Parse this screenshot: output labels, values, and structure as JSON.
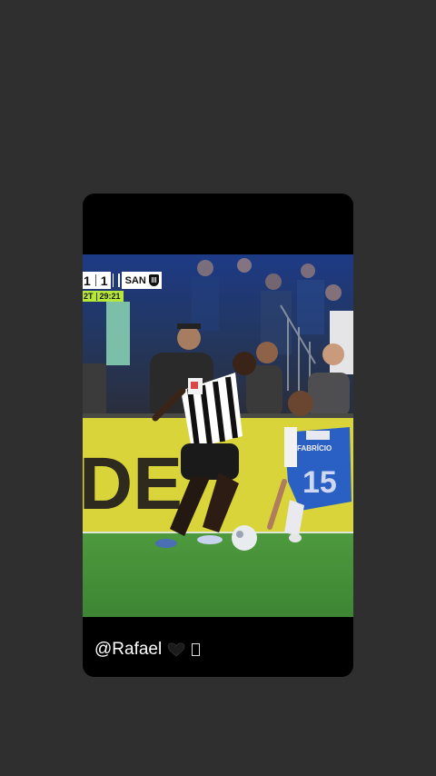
{
  "story": {
    "video": {
      "scorebug": {
        "home_score": "1",
        "away_score": "1",
        "away_team": "SAN",
        "period": "2T",
        "clock": "29:21"
      },
      "shirt_name": "FABRÍCIO",
      "shirt_number": "15",
      "board_text": "DE"
    },
    "caption": {
      "username": "@Rafael",
      "icons": [
        "black-heart-icon",
        "missing-glyph-icon"
      ]
    }
  },
  "colors": {
    "background": "#302f2f",
    "card": "#000000",
    "scorebug_accent": "#b6e83a"
  }
}
